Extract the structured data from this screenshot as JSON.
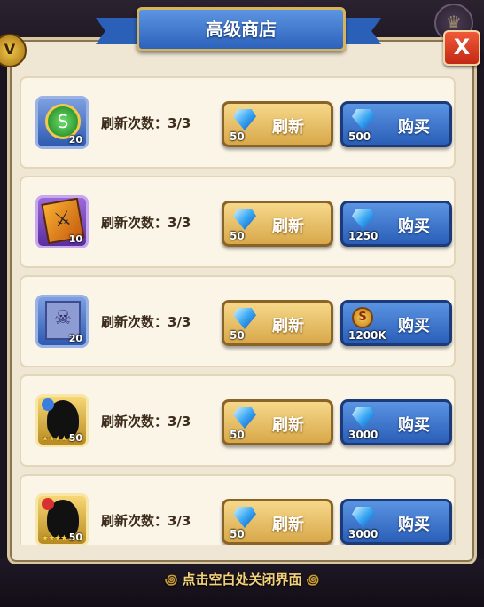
{
  "shop": {
    "title": "高级商店",
    "close_label": "X",
    "footer_hint": "点击空白处关闭界面",
    "corner_medal_label": "V",
    "items": [
      {
        "count": "20",
        "frame": "gold",
        "art": "green-coin-icon",
        "art_glyph": "S",
        "refresh_label": "刷新次数：3/3",
        "refresh_button": "刷新",
        "refresh_cost": "50",
        "buy_button": "购买",
        "buy_cost": "500",
        "buy_currency": "gem"
      },
      {
        "count": "10",
        "frame": "purple",
        "art": "hero-card-icon",
        "art_glyph": "⚔",
        "refresh_label": "刷新次数：3/3",
        "refresh_button": "刷新",
        "refresh_cost": "50",
        "buy_button": "购买",
        "buy_cost": "1250",
        "buy_currency": "gem"
      },
      {
        "count": "20",
        "frame": "blue",
        "art": "scroll-icon",
        "art_glyph": "☠",
        "refresh_label": "刷新次数：3/3",
        "refresh_button": "刷新",
        "refresh_cost": "50",
        "buy_button": "购买",
        "buy_cost": "1200K",
        "buy_currency": "gold",
        "gold_glyph": "S"
      },
      {
        "count": "50",
        "frame": "gold",
        "art": "hero-silhouette-icon",
        "stars": "★★★★★",
        "badge_color": "#3a7ee0",
        "refresh_label": "刷新次数：3/3",
        "refresh_button": "刷新",
        "refresh_cost": "50",
        "buy_button": "购买",
        "buy_cost": "3000",
        "buy_currency": "gem"
      },
      {
        "count": "50",
        "frame": "gold",
        "art": "hero-silhouette-icon",
        "stars": "★★★★",
        "badge_color": "#d83030",
        "refresh_label": "刷新次数：3/3",
        "refresh_button": "刷新",
        "refresh_cost": "50",
        "buy_button": "购买",
        "buy_cost": "3000",
        "buy_currency": "gem"
      }
    ]
  }
}
